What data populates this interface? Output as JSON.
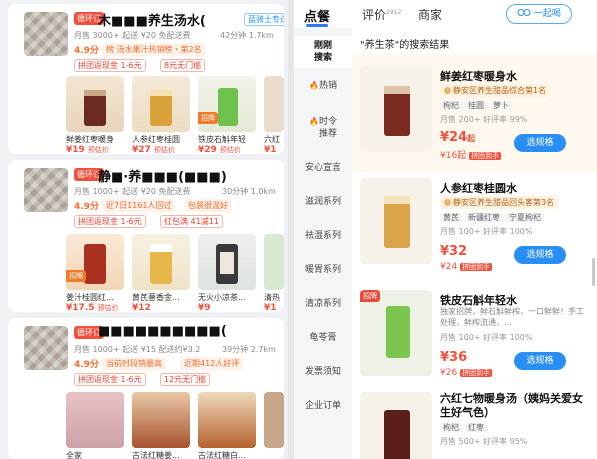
{
  "colors": {
    "accent_blue": "#2a8ff5",
    "price_red": "#f0503c",
    "tag_orange": "#f26a2e"
  },
  "stores": [
    {
      "badge": "循环订",
      "name": "木■■■养生汤水(",
      "tag": "蓝骑士专送",
      "sub1": "月售 3000+  起送 ¥20  免配送费",
      "sub1_right": "42分钟  1.7km",
      "rating": "4.9分",
      "rank": "榜  汤水果汁热销榜・第2名",
      "promo1": "拼团返现金 1-6元",
      "promo2": "8元无门槛",
      "products": [
        {
          "name": "鲜姜红枣暖身",
          "price": "¥19",
          "note": "预估价",
          "label": ""
        },
        {
          "name": "人参红枣桂圆",
          "price": "¥27",
          "note": "预估价",
          "label": ""
        },
        {
          "name": "铁皮石斛年轻",
          "price": "¥29",
          "note": "预估价",
          "label": "招牌"
        },
        {
          "name": "六红",
          "price": "¥1",
          "note": "",
          "label": ""
        }
      ]
    },
    {
      "badge": "循环订",
      "name": "静■·养■■■(■■■)",
      "tag": "",
      "sub1": "月售 1000+  起送 ¥20  免配送费",
      "sub1_right": "30分钟  1.0km",
      "rating": "4.9分",
      "rank": "近7日1161人回过",
      "rank2": "包装很温好",
      "promo1": "拼团返现金 1-6元",
      "promo2": "红包满 41减11",
      "products": [
        {
          "name": "姜汁桂圆红...",
          "price": "¥17.5",
          "note": "预估价",
          "label": "招牌"
        },
        {
          "name": "黄芪薏香金...",
          "price": "¥12",
          "note": "",
          "label": ""
        },
        {
          "name": "无火小凉茶...",
          "price": "¥9",
          "note": "",
          "label": ""
        },
        {
          "name": "清热",
          "price": "¥1",
          "note": "",
          "label": ""
        }
      ]
    },
    {
      "badge": "循环订",
      "name": "■■■■■■■■■■(",
      "tag": "",
      "sub1": "月售 1000+  起送 ¥15  配送约¥3.2",
      "sub1_right": "39分钟  2.7km",
      "rating": "4.9分",
      "rank": "当前时段销量高",
      "rank2": "近期412人好评",
      "promo1": "拼团返现金 1-6元",
      "promo2": "12元无门槛",
      "products": [
        {
          "name": "全家",
          "price": "",
          "note": "",
          "label": ""
        },
        {
          "name": "古法红糖姜...",
          "price": "",
          "note": "",
          "label": ""
        },
        {
          "name": "古法红糖白...",
          "price": "",
          "note": "",
          "label": ""
        },
        {
          "name": "",
          "price": "",
          "note": "",
          "label": ""
        }
      ]
    }
  ],
  "right": {
    "tabs": [
      {
        "label": "点餐",
        "active": true
      },
      {
        "label": "评价",
        "count": "2912"
      },
      {
        "label": "商家"
      }
    ],
    "together": "一起喝",
    "categories": [
      {
        "label": "刚刚\n搜索",
        "active": true
      },
      {
        "label": "热销",
        "fire": true
      },
      {
        "label": "时令\n推荐",
        "fire": true
      },
      {
        "label": "安心宣言"
      },
      {
        "label": "滋润系列"
      },
      {
        "label": "祛湿系列"
      },
      {
        "label": "暖胃系列"
      },
      {
        "label": "清凉系列"
      },
      {
        "label": "龟苓膏"
      },
      {
        "label": "发票须知"
      },
      {
        "label": "企业订单"
      }
    ],
    "result_title": "\"养生茶\"的搜索结果",
    "items": [
      {
        "name": "鲜姜红枣暖身水",
        "rank": "静安区养生甜品综合第1名",
        "tags": [
          "枸杞",
          "桂圆",
          "萝卜"
        ],
        "sales": "月售 200+  好评率 99%",
        "price": "¥24",
        "price_suffix": "起",
        "price2": "¥16起",
        "price2_tag": "拼团到手",
        "spec": "选规格",
        "highlight": true
      },
      {
        "name": "人参红枣桂圆水",
        "rank": "静安区养生甜品回头客第3名",
        "tags": [
          "黄芪",
          "新疆红枣",
          "宁夏枸杞"
        ],
        "sales": "月售 100+  好评率 100%",
        "price": "¥32",
        "price2": "¥24",
        "price2_tag": "拼团到手",
        "spec": "选规格"
      },
      {
        "label": "招牌",
        "name": "铁皮石斛年轻水",
        "desc": "独家招牌，鲜石斛鲜榨，一口鲜鲜！手工处理，鲜榨流通，...",
        "sales": "月售 100+  好评率 100%",
        "price": "¥36",
        "price2": "¥26",
        "price2_tag": "拼团到手",
        "spec": "选规格"
      },
      {
        "name": "六红七物暖身汤（姨妈关爱女生好气色）",
        "tags": [
          "枸杞",
          "红枣"
        ],
        "sales": "月售 500+  好评率 95%"
      }
    ]
  }
}
